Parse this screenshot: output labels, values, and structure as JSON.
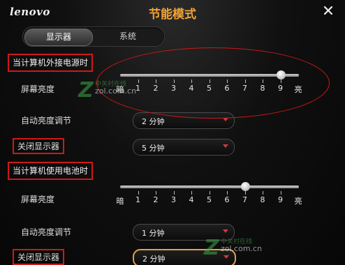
{
  "window": {
    "brand": "lenovo",
    "title": "节能模式"
  },
  "tabs": [
    {
      "label": "显示器",
      "active": true
    },
    {
      "label": "系统",
      "active": false
    }
  ],
  "ac_section": {
    "header": "当计算机外接电源时",
    "brightness_label": "屏幕亮度",
    "brightness_level": 9,
    "auto_brightness_label": "自动亮度调节",
    "auto_brightness_value": "2 分钟",
    "display_off_label": "关闭显示器",
    "display_off_value": "5 分钟"
  },
  "battery_section": {
    "header": "当计算机使用电池时",
    "brightness_label": "屏幕亮度",
    "brightness_level": 7,
    "auto_brightness_label": "自动亮度调节",
    "auto_brightness_value": "1 分钟",
    "display_off_label": "关闭显示器",
    "display_off_value": "2 分钟"
  },
  "scale": {
    "min_label": "暗",
    "max_label": "亮",
    "ticks": [
      "1",
      "2",
      "3",
      "4",
      "5",
      "6",
      "7",
      "8",
      "9"
    ]
  },
  "watermark": {
    "cn": "中关村在线",
    "url": "zol.com.cn"
  },
  "colors": {
    "title": "#f2a433",
    "annotation": "#d01818",
    "caret": "#d43a3a"
  }
}
